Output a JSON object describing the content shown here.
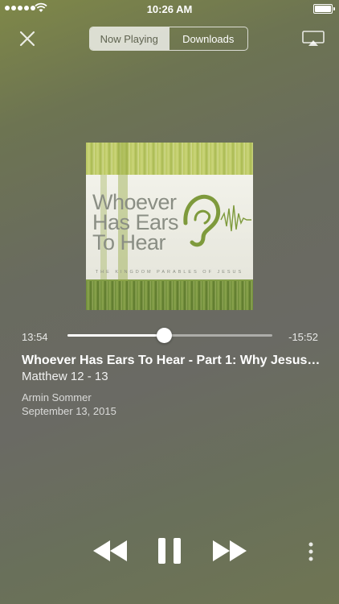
{
  "status_bar": {
    "time": "10:26 AM"
  },
  "header": {
    "tabs": [
      {
        "label": "Now Playing",
        "active": true
      },
      {
        "label": "Downloads",
        "active": false
      }
    ]
  },
  "artwork": {
    "title": "Whoever Has Ears To Hear",
    "subtitle": "THE KINGDOM PARABLES OF JESUS"
  },
  "player": {
    "elapsed": "13:54",
    "remaining": "-15:52",
    "progress": 0.47
  },
  "episode": {
    "title": "Whoever Has Ears To Hear - Part 1: Why Jesus…",
    "reference": "Matthew 12 - 13",
    "speaker": "Armin Sommer",
    "date": "September 13, 2015"
  },
  "icons": {
    "close": "close-icon",
    "airplay": "airplay-icon",
    "rewind": "rewind-icon",
    "pause": "pause-icon",
    "fast_forward": "fast-forward-icon",
    "more": "more-vertical-icon"
  },
  "colors": {
    "accent": "#ffffff",
    "ear_green": "#7e9a3c"
  }
}
